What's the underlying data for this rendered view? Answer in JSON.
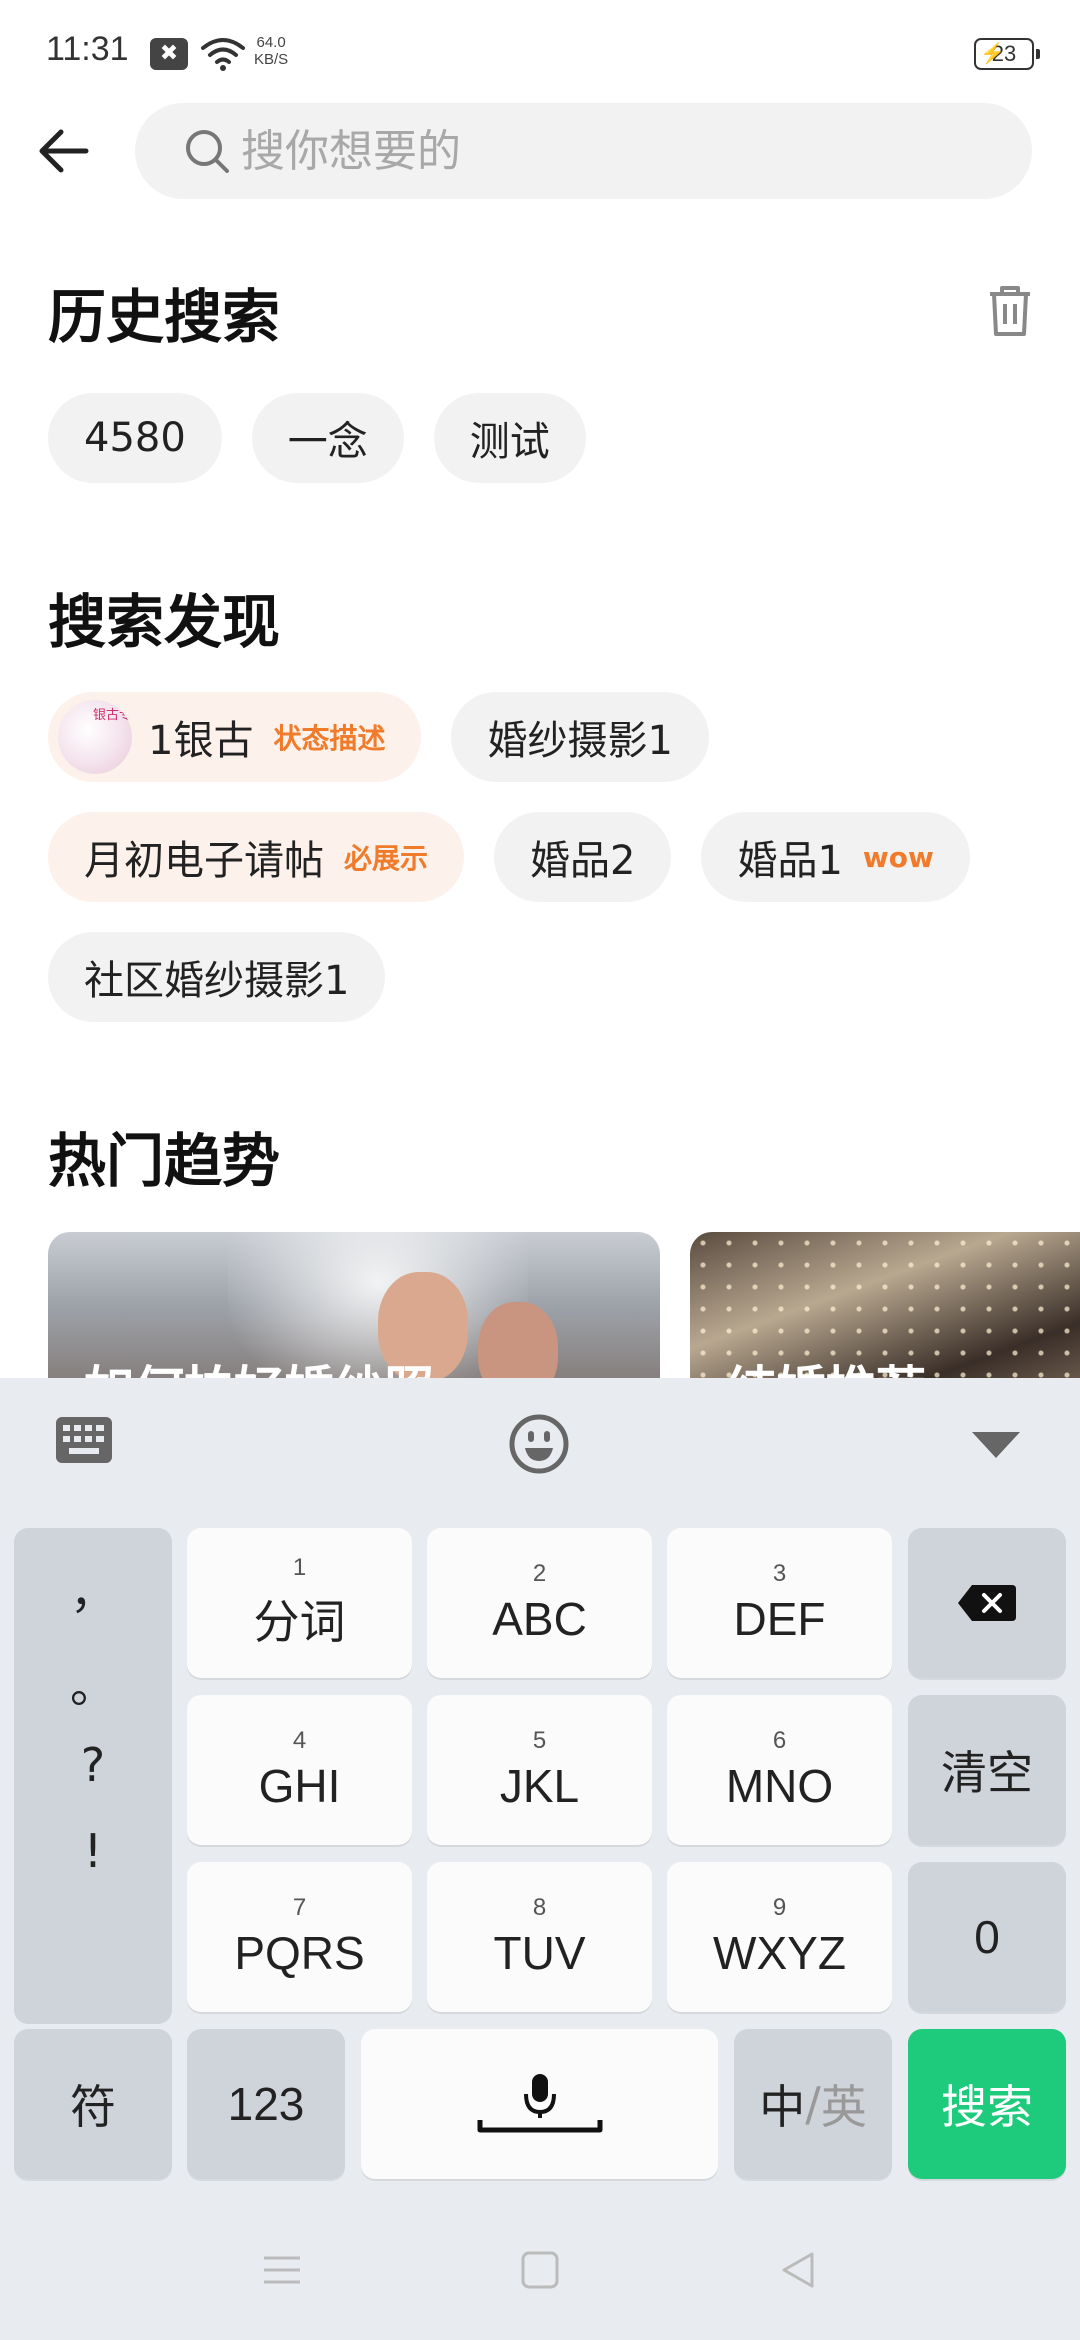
{
  "status_bar": {
    "time": "11:31",
    "net_speed_value": "64.0",
    "net_speed_unit": "KB/S",
    "battery": "23"
  },
  "search": {
    "placeholder": "搜你想要的"
  },
  "history": {
    "title": "历史搜索",
    "items": [
      "4580",
      "一念",
      "测试"
    ]
  },
  "discover": {
    "title": "搜索发现",
    "items": [
      {
        "label": "1银古",
        "tag": "状态描述",
        "thumb_text": "银古专用"
      },
      {
        "label": "婚纱摄影1"
      },
      {
        "label": "月初电子请帖",
        "tag": "必展示"
      },
      {
        "label": "婚品2"
      },
      {
        "label": "婚品1",
        "tag": "wow"
      },
      {
        "label": "社区婚纱摄影1"
      }
    ]
  },
  "trends": {
    "title": "热门趋势",
    "cards": [
      {
        "title": "如何拍好婚纱照"
      },
      {
        "title": "结婚推荐"
      }
    ]
  },
  "keyboard": {
    "punctuation": [
      "，",
      "。",
      "?",
      "!"
    ],
    "keys": [
      {
        "num": "1",
        "label": "分词"
      },
      {
        "num": "2",
        "label": "ABC"
      },
      {
        "num": "3",
        "label": "DEF"
      },
      {
        "num": "4",
        "label": "GHI"
      },
      {
        "num": "5",
        "label": "JKL"
      },
      {
        "num": "6",
        "label": "MNO"
      },
      {
        "num": "7",
        "label": "PQRS"
      },
      {
        "num": "8",
        "label": "TUV"
      },
      {
        "num": "9",
        "label": "WXYZ"
      }
    ],
    "clear": "清空",
    "zero": "0",
    "symbols": "符",
    "numbers": "123",
    "lang_zh": "中",
    "lang_sep": "/",
    "lang_en": "英",
    "search": "搜索"
  },
  "colors": {
    "accent_orange": "#f07b2a",
    "search_green": "#1ecb7c"
  }
}
